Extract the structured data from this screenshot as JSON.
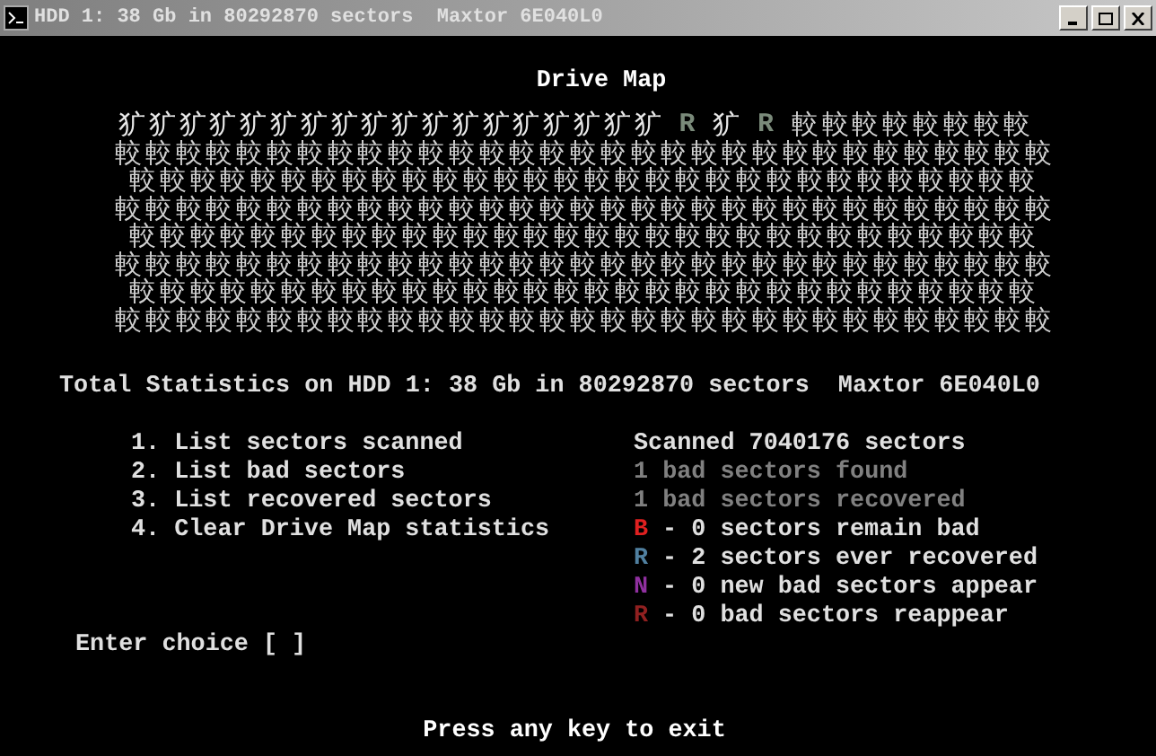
{
  "window": {
    "title": "HDD 1: 38 Gb in 80292870 sectors  Maxtor 6E040L0"
  },
  "heading": "Drive Map",
  "drive_map": {
    "rows": [
      {
        "segments": [
          {
            "kind": "scanned",
            "text": "犷犷犷犷犷犷犷犷犷犷犷犷犷犷犷犷犷犷"
          },
          {
            "kind": "recovered",
            "text": "R"
          },
          {
            "kind": "scanned",
            "text": "犷"
          },
          {
            "kind": "recovered",
            "text": "R"
          },
          {
            "kind": "unscanned",
            "text": "較較較較較較較較"
          }
        ]
      },
      {
        "segments": [
          {
            "kind": "unscanned",
            "text": "較較較較較較較較較較較較較較較較較較較較較較較較較較較較較較較"
          }
        ]
      },
      {
        "segments": [
          {
            "kind": "unscanned",
            "text": "較較較較較較較較較較較較較較較較較較較較較較較較較較較較較較"
          }
        ]
      },
      {
        "segments": [
          {
            "kind": "unscanned",
            "text": "較較較較較較較較較較較較較較較較較較較較較較較較較較較較較較較"
          }
        ]
      },
      {
        "segments": [
          {
            "kind": "unscanned",
            "text": "較較較較較較較較較較較較較較較較較較較較較較較較較較較較較較"
          }
        ]
      },
      {
        "segments": [
          {
            "kind": "unscanned",
            "text": "較較較較較較較較較較較較較較較較較較較較較較較較較較較較較較較"
          }
        ]
      },
      {
        "segments": [
          {
            "kind": "unscanned",
            "text": "較較較較較較較較較較較較較較較較較較較較較較較較較較較較較較"
          }
        ]
      },
      {
        "segments": [
          {
            "kind": "unscanned",
            "text": "較較較較較較較較較較較較較較較較較較較較較較較較較較較較較較較"
          }
        ]
      }
    ]
  },
  "total_statistics": "Total Statistics on HDD 1: 38 Gb in 80292870 sectors  Maxtor 6E040L0",
  "menu": [
    "1. List sectors scanned",
    "2. List bad sectors",
    "3. List recovered sectors",
    "4. Clear Drive Map statistics"
  ],
  "stats": [
    {
      "text": "Scanned 7040176 sectors",
      "dim": false
    },
    {
      "text": "1 bad sectors found",
      "dim": true
    },
    {
      "text": "1 bad sectors recovered",
      "dim": true
    }
  ],
  "legend": [
    {
      "letter": "B",
      "color": "#e02020",
      "text": "- 0 sectors remain bad"
    },
    {
      "letter": "R",
      "color": "#5080a0",
      "text": "- 2 sectors ever recovered"
    },
    {
      "letter": "N",
      "color": "#9030a0",
      "text": "- 0 new bad sectors appear"
    },
    {
      "letter": "R",
      "color": "#902020",
      "text": "- 0 bad sectors reappear"
    }
  ],
  "prompt": "Enter choice [ ]",
  "footer": "Press any key to exit"
}
